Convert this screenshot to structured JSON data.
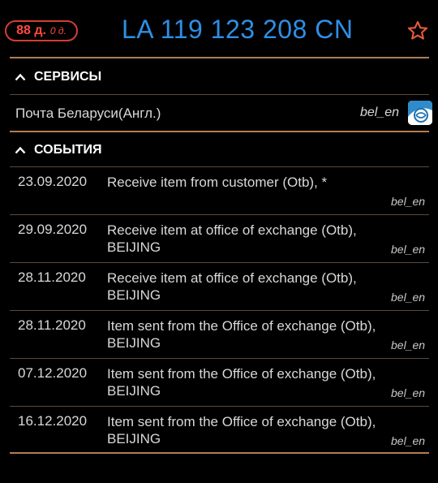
{
  "header": {
    "days_main": "88 д.",
    "days_sub": "0 д.",
    "tracking_number": "LA 119 123 208 CN",
    "favorite_icon": "star-outline-icon"
  },
  "colors": {
    "accent_blue": "#2e8fe6",
    "badge_red": "#ff4a3d",
    "separator": "#b27d55",
    "star": "#e85a3a"
  },
  "services": {
    "title": "СЕРВИСЫ",
    "items": [
      {
        "name": "Почта Беларуси(Англ.)",
        "code": "bel_en",
        "icon": "belpost-logo-icon"
      }
    ]
  },
  "events": {
    "title": "СОБЫТИЯ",
    "items": [
      {
        "date": "23.09.2020",
        "text": "Receive item from customer (Otb), *",
        "code": "bel_en"
      },
      {
        "date": "29.09.2020",
        "text": "Receive item at office of exchange (Otb), BEIJING",
        "code": "bel_en"
      },
      {
        "date": "28.11.2020",
        "text": "Receive item at office of exchange (Otb), BEIJING",
        "code": "bel_en"
      },
      {
        "date": "28.11.2020",
        "text": "Item sent from the Office of exchange (Otb), BEIJING",
        "code": "bel_en"
      },
      {
        "date": "07.12.2020",
        "text": "Item sent from the Office of exchange (Otb), BEIJING",
        "code": "bel_en"
      },
      {
        "date": "16.12.2020",
        "text": "Item sent from the Office of exchange (Otb), BEIJING",
        "code": "bel_en"
      }
    ]
  }
}
